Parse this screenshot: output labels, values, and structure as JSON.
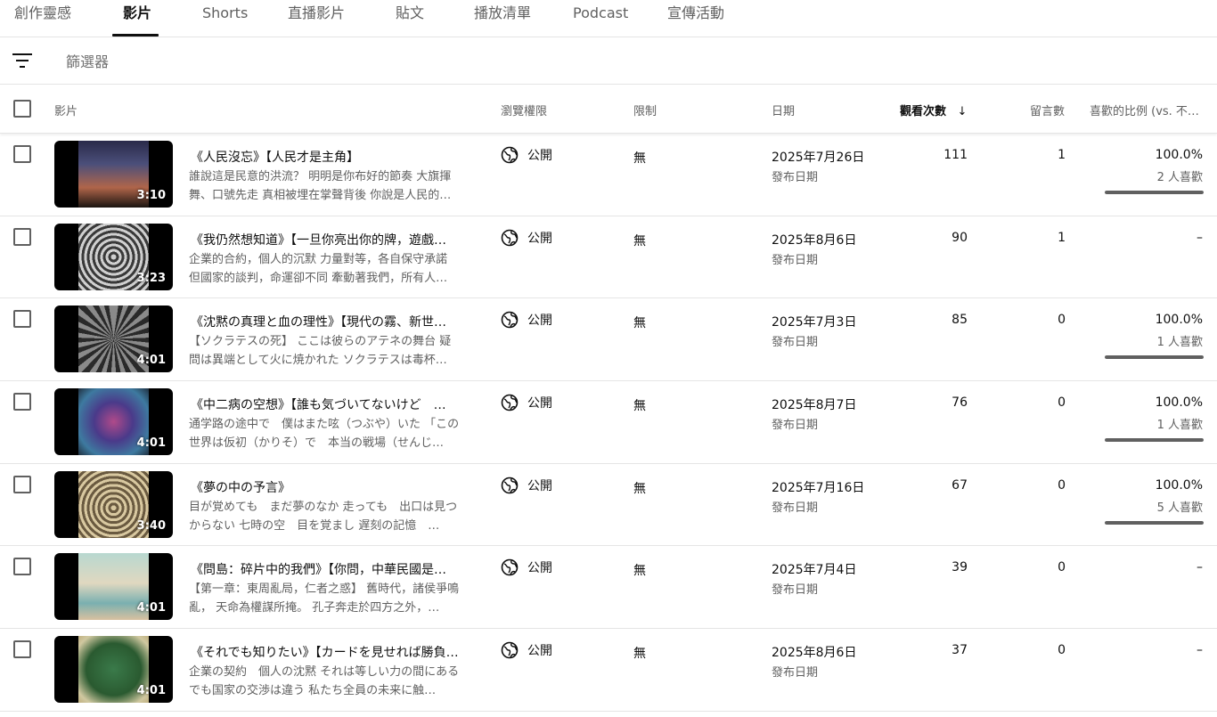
{
  "tabs": [
    {
      "label": "創作靈感",
      "active": false
    },
    {
      "label": "影片",
      "active": true
    },
    {
      "label": "Shorts",
      "active": false
    },
    {
      "label": "直播影片",
      "active": false
    },
    {
      "label": "貼文",
      "active": false
    },
    {
      "label": "播放清單",
      "active": false
    },
    {
      "label": "Podcast",
      "active": false
    },
    {
      "label": "宣傳活動",
      "active": false
    }
  ],
  "filter": {
    "placeholder": "篩選器"
  },
  "columns": {
    "video": "影片",
    "visibility": "瀏覽權限",
    "restrictions": "限制",
    "date": "日期",
    "views": "觀看次數",
    "sort_arrow": "↓",
    "comments": "留言數",
    "likes": "喜歡的比例 (vs. 不…"
  },
  "colors": {
    "text": "#0f0f0f",
    "secondary": "#606060",
    "divider": "#e5e5e5"
  },
  "rows": [
    {
      "title": "《人民沒忘》【人民才是主角】",
      "description": "誰說這是民意的洪流？ 明明是你布好的節奏 大旗揮舞、口號先走 真相被埋在掌聲背後 你說是人民的…",
      "duration": "3:10",
      "thumbnail": "storm-city",
      "visibility": "公開",
      "restriction": "無",
      "date": "2025年7月26日",
      "date_label": "發布日期",
      "views": "111",
      "comments": "1",
      "like_pct": "100.0%",
      "like_count": "2 人喜歡",
      "like_ratio": 1.0
    },
    {
      "title": "《我仍然想知道》【一旦你亮出你的牌，遊戲…",
      "description": "企業的合約，個人的沉默 力量對等，各自保守承諾 但國家的談判，命運卻不同 牽動著我們，所有人…",
      "duration": "3:23",
      "thumbnail": "maze-gray",
      "visibility": "公開",
      "restriction": "無",
      "date": "2025年8月6日",
      "date_label": "發布日期",
      "views": "90",
      "comments": "1",
      "like_pct": "–",
      "like_count": "",
      "like_ratio": null
    },
    {
      "title": "《沈黙の真理と血の理性》【現代の霧、新世…",
      "description": "【ソクラテスの死】 ここは彼らのアテネの舞台 疑問は異端として火に焼かれた ソクラテスは毒杯…",
      "duration": "4:01",
      "thumbnail": "gears",
      "visibility": "公開",
      "restriction": "無",
      "date": "2025年7月3日",
      "date_label": "發布日期",
      "views": "85",
      "comments": "0",
      "like_pct": "100.0%",
      "like_count": "1 人喜歡",
      "like_ratio": 1.0
    },
    {
      "title": "《中二病の空想》【誰も気づいてないけど　…",
      "description": "通学路の途中で　僕はまた呟（つぶや）いた 「この世界は仮初（かりそ）で　本当の戦場（せんじ…",
      "duration": "4:01",
      "thumbnail": "dragon",
      "visibility": "公開",
      "restriction": "無",
      "date": "2025年8月7日",
      "date_label": "發布日期",
      "views": "76",
      "comments": "0",
      "like_pct": "100.0%",
      "like_count": "1 人喜歡",
      "like_ratio": 1.0
    },
    {
      "title": "《夢の中の予言》",
      "description": "目が覚めても　まだ夢のなか 走っても　出口は見つからない 七時の空　目を覚まし 遅刻の記憶　…",
      "duration": "3:40",
      "thumbnail": "maze-sepia",
      "visibility": "公開",
      "restriction": "無",
      "date": "2025年7月16日",
      "date_label": "發布日期",
      "views": "67",
      "comments": "0",
      "like_pct": "100.0%",
      "like_count": "5 人喜歡",
      "like_ratio": 1.0
    },
    {
      "title": "《問島：碎片中的我們》【你問，中華民國是…",
      "description": "【第一章：東周亂局，仁者之惑】 舊時代，諸侯爭鳴亂， 天命為權謀所掩。 孔子奔走於四方之外，…",
      "duration": "4:01",
      "thumbnail": "island-beach",
      "visibility": "公開",
      "restriction": "無",
      "date": "2025年7月4日",
      "date_label": "發布日期",
      "views": "39",
      "comments": "0",
      "like_pct": "–",
      "like_count": "",
      "like_ratio": null
    },
    {
      "title": "《それでも知りたい》【カードを見せれば勝負…",
      "description": "企業の契約　個人の沈黙 それは等しい力の間にある でも国家の交渉は違う 私たち全員の未来に触…",
      "duration": "4:01",
      "thumbnail": "world-map",
      "visibility": "公開",
      "restriction": "無",
      "date": "2025年8月6日",
      "date_label": "發布日期",
      "views": "37",
      "comments": "0",
      "like_pct": "–",
      "like_count": "",
      "like_ratio": null
    }
  ]
}
